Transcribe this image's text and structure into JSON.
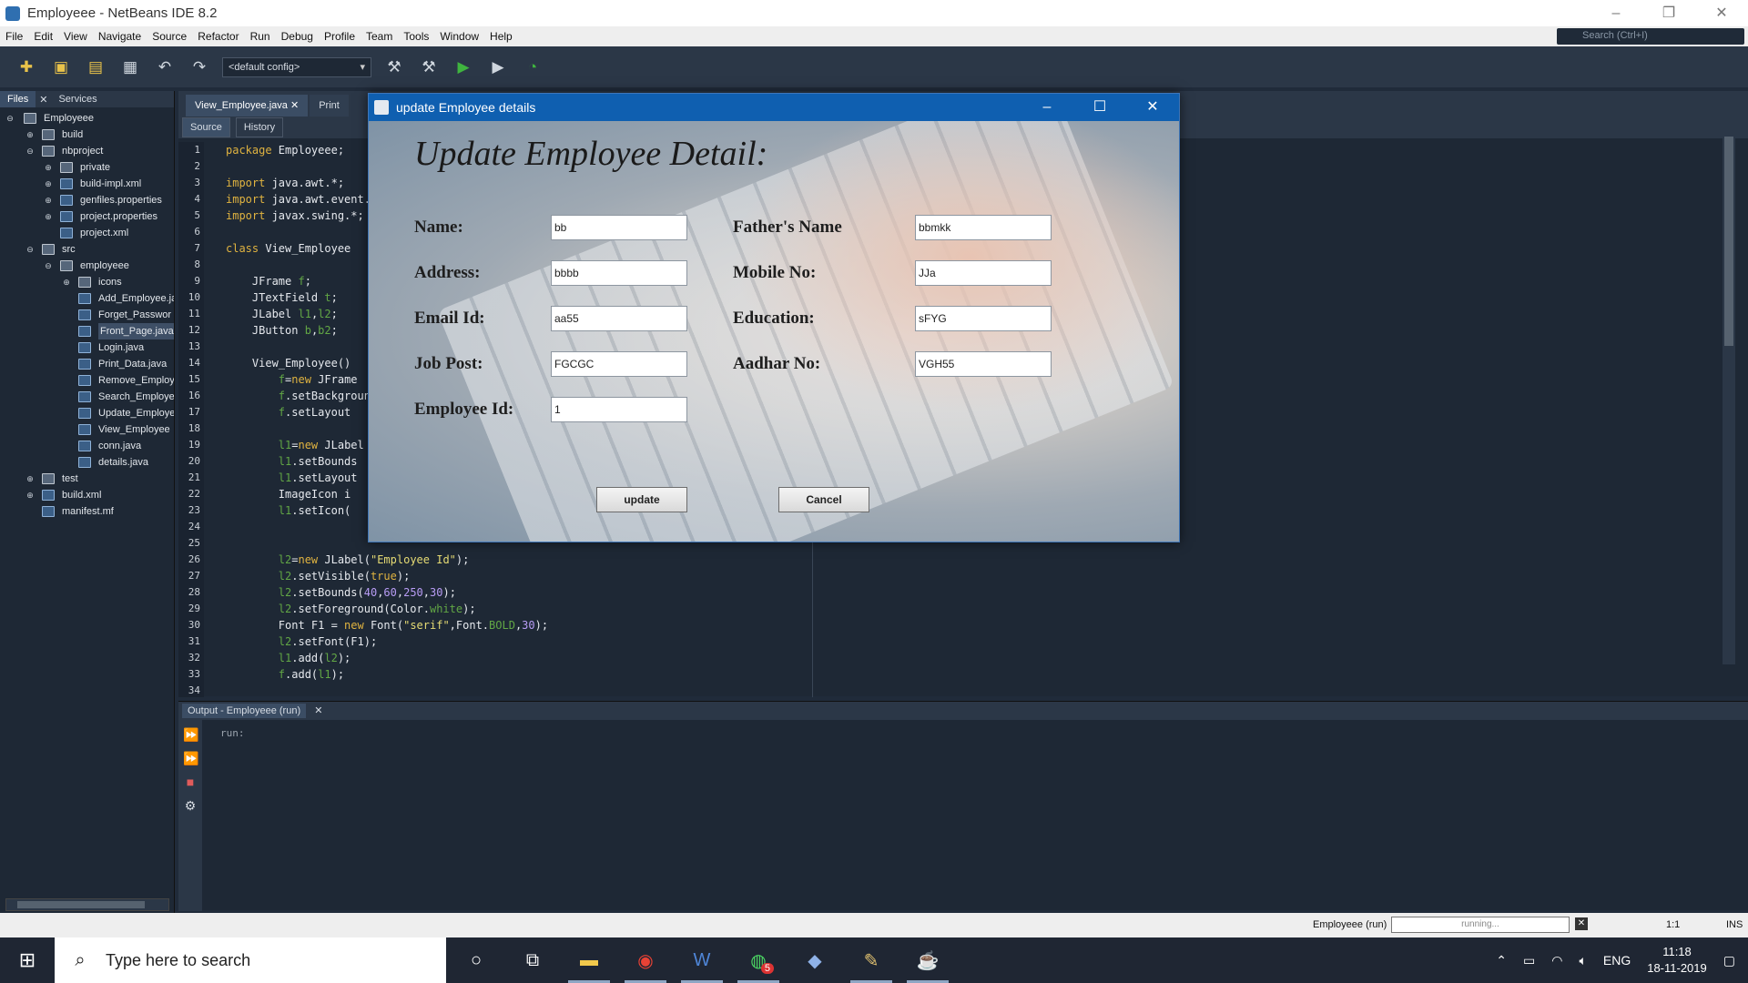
{
  "window": {
    "title": "Employeee - NetBeans IDE 8.2",
    "controls": [
      "–",
      "❐",
      "✕"
    ]
  },
  "menu": {
    "items": [
      "File",
      "Edit",
      "View",
      "Navigate",
      "Source",
      "Refactor",
      "Run",
      "Debug",
      "Profile",
      "Team",
      "Tools",
      "Window",
      "Help"
    ],
    "search_placeholder": "Search (Ctrl+I)"
  },
  "toolbar": {
    "config_value": "<default config>"
  },
  "left_panel": {
    "tabs": [
      "Files",
      "Services"
    ],
    "tree": [
      {
        "label": "Employeee"
      },
      {
        "label": "build"
      },
      {
        "label": "nbproject"
      },
      {
        "label": "private"
      },
      {
        "label": "build-impl.xml"
      },
      {
        "label": "genfiles.properties"
      },
      {
        "label": "project.properties"
      },
      {
        "label": "project.xml"
      },
      {
        "label": "src"
      },
      {
        "label": "employeee"
      },
      {
        "label": "icons"
      },
      {
        "label": "Add_Employee.ja"
      },
      {
        "label": "Forget_Passwor"
      },
      {
        "label": "Front_Page.java"
      },
      {
        "label": "Login.java"
      },
      {
        "label": "Print_Data.java"
      },
      {
        "label": "Remove_Employ"
      },
      {
        "label": "Search_Employe"
      },
      {
        "label": "Update_Employe"
      },
      {
        "label": "View_Employee"
      },
      {
        "label": "conn.java"
      },
      {
        "label": "details.java"
      },
      {
        "label": "test"
      },
      {
        "label": "build.xml"
      },
      {
        "label": "manifest.mf"
      }
    ]
  },
  "editor": {
    "tabs": [
      "View_Employee.java",
      "Print"
    ],
    "source_tab": "Source",
    "history_tab": "History",
    "line_numbers": [
      "1",
      "2",
      "3",
      "4",
      "5",
      "6",
      "7",
      "8",
      "9",
      "10",
      "11",
      "12",
      "13",
      "14",
      "15",
      "16",
      "17",
      "18",
      "19",
      "20",
      "21",
      "22",
      "23",
      "24",
      "25",
      "26",
      "27",
      "28",
      "29",
      "30",
      "31",
      "32",
      "33",
      "34"
    ]
  },
  "output": {
    "title": "Output - Employeee (run)",
    "text": "run:"
  },
  "status": {
    "run_label": "Employeee (run)",
    "progress_text": "running...",
    "position": "1:1",
    "mode": "INS"
  },
  "dialog": {
    "title": "update Employee details",
    "heading": "Update Employee Detail:",
    "labels": {
      "name": "Name:",
      "father": "Father's Name",
      "address": "Address:",
      "mobile": "Mobile No:",
      "email": "Email Id:",
      "education": "Education:",
      "job_post": "Job Post:",
      "aadhar": "Aadhar No:",
      "employee_id": "Employee Id:"
    },
    "values": {
      "name": "bb",
      "father": "bbmkk",
      "address": "bbbb",
      "mobile": "JJa",
      "email": "aa55",
      "education": "sFYG",
      "job_post": "FGCGC",
      "aadhar": "VGH55",
      "employee_id": "1"
    },
    "buttons": {
      "update": "update",
      "cancel": "Cancel"
    }
  },
  "taskbar": {
    "search_placeholder": "Type here to search",
    "language": "ENG",
    "time": "11:18",
    "date": "18-11-2019",
    "badge": "5"
  }
}
